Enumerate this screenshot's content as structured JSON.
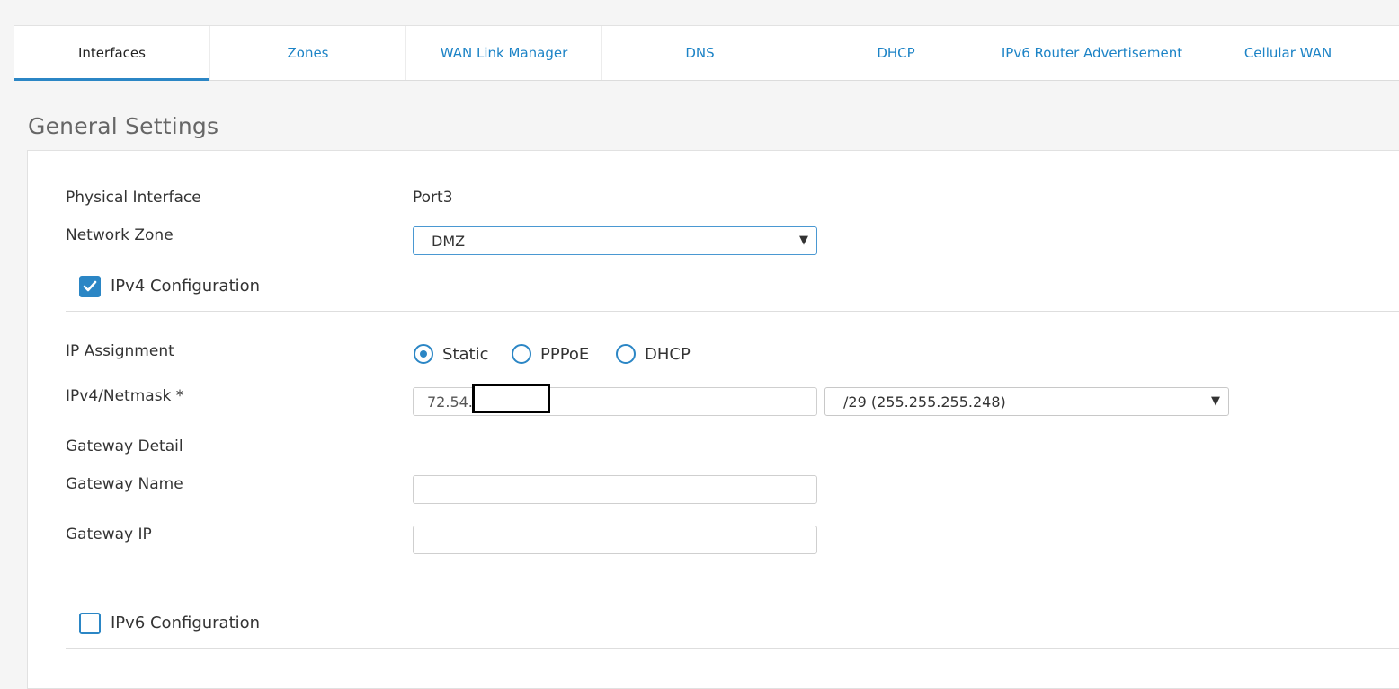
{
  "tabs": [
    {
      "label": "Interfaces",
      "active": true
    },
    {
      "label": "Zones"
    },
    {
      "label": "WAN Link Manager"
    },
    {
      "label": "DNS"
    },
    {
      "label": "DHCP"
    },
    {
      "label": "IPv6 Router Advertisement"
    },
    {
      "label": "Cellular WAN"
    }
  ],
  "section_title": "General Settings",
  "form": {
    "physical_interface_label": "Physical Interface",
    "physical_interface_value": "Port3",
    "network_zone_label": "Network Zone",
    "network_zone_value": "DMZ",
    "ipv4_config_label": "IPv4 Configuration",
    "ipv4_config_checked": true,
    "ip_assignment_label": "IP Assignment",
    "ip_assignment_options": [
      "Static",
      "PPPoE",
      "DHCP"
    ],
    "ip_assignment_selected": "Static",
    "ipv4_netmask_label": "IPv4/Netmask *",
    "ipv4_value": "72.54.",
    "netmask_value": "/29 (255.255.255.248)",
    "gateway_detail_label": "Gateway Detail",
    "gateway_name_label": "Gateway Name",
    "gateway_name_value": "",
    "gateway_ip_label": "Gateway IP",
    "gateway_ip_value": "",
    "ipv6_config_label": "IPv6 Configuration",
    "ipv6_config_checked": false
  },
  "colors": {
    "accent": "#2b86c5",
    "tab_link": "#1c83c6",
    "background": "#f5f5f5"
  },
  "icons": {
    "dropdown": "triangle-down-icon",
    "check": "checkmark-icon"
  }
}
